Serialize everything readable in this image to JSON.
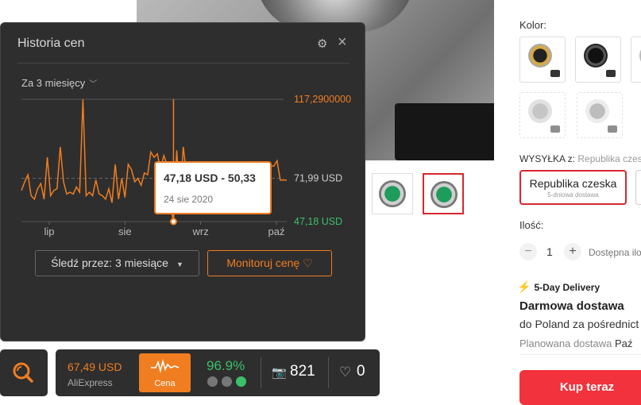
{
  "product": {
    "color_label": "Kolor:",
    "shipping_label": "WYSYŁKA z:",
    "shipping_from": "Republika czeska",
    "shipping_option": {
      "name": "Republika czeska",
      "sub": "5-dniowa dostawa"
    },
    "quantity_label": "Ilość:",
    "quantity": "1",
    "minus": "−",
    "plus": "+",
    "availability": "Dostępna ilo",
    "delivery_badge": "5-Day Delivery",
    "free_delivery": "Darmowa dostawa",
    "to_poland": "do Poland za pośrednict",
    "planned_label": "Planowana dostawa",
    "planned_value": "Paź",
    "buy_button": "Kup teraz"
  },
  "price_history": {
    "title": "Historia cen",
    "settings_icon": "gear-icon",
    "close_icon": "close-icon",
    "period": "Za 3 miesięcy",
    "tooltip_price": "47,18 USD - 50,33",
    "tooltip_date": "24 sie 2020",
    "follow_label": "Śledź przez: 3 miesiące",
    "monitor_label": "Monitoruj cenę ♡",
    "colors": {
      "line": "#f07d20",
      "max": "#f07d20",
      "min": "#3ac169",
      "avg": "#cccccc"
    }
  },
  "chart_data": {
    "type": "line",
    "x_tick_labels": [
      "lip",
      "sie",
      "wrz",
      "paź"
    ],
    "level_labels": {
      "max": "117,2900000",
      "avg": "71,99 USD",
      "min": "47,18 USD"
    },
    "max": 117.29,
    "avg": 71.99,
    "min": 47.18,
    "ylim": [
      47.18,
      117.29
    ],
    "series": [
      {
        "values": [
          65,
          70,
          74,
          62,
          60,
          66,
          69,
          60,
          84,
          62,
          65,
          66,
          90,
          70,
          63,
          64,
          63,
          67,
          64,
          117.29,
          62,
          64,
          62,
          71,
          63,
          62,
          60,
          66,
          58,
          80,
          60,
          72,
          61,
          80,
          77,
          70,
          72,
          68,
          75,
          74,
          87,
          84,
          86,
          77,
          85,
          80,
          56,
          47.18,
          88,
          58,
          90,
          75,
          76,
          78,
          78,
          78,
          78,
          78,
          75,
          75,
          79,
          79,
          79,
          79,
          79,
          79,
          79,
          79,
          79,
          79,
          79,
          79,
          79,
          79,
          79,
          79,
          75,
          79,
          79,
          82,
          71,
          71,
          71
        ]
      }
    ],
    "highlight_index": 47
  },
  "toolbar": {
    "price": "67,49 USD",
    "source": "AliExpress",
    "cena": "Cena",
    "rating": "96.9%",
    "photos": "821",
    "likes": "0"
  }
}
